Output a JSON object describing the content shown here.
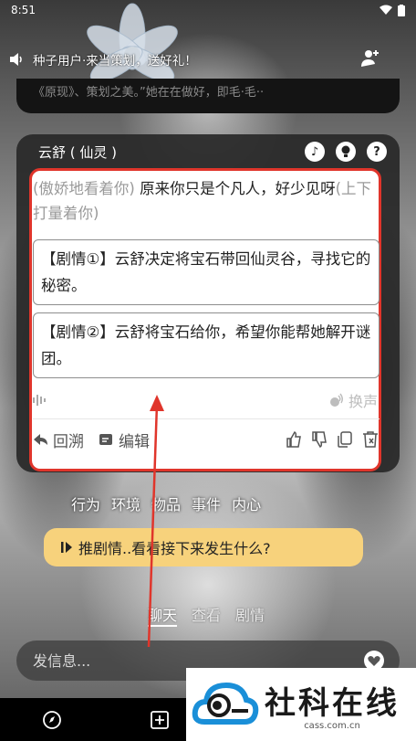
{
  "status_bar": {
    "time": "8:51"
  },
  "announcement": {
    "text": "种子用户·来当策划，送好礼！"
  },
  "previous_message": {
    "text": "《原现》、策划之美。”她在在做好，即毛·毛··"
  },
  "character": {
    "name": "云舒 ( 仙灵 )"
  },
  "message": {
    "action1": "(傲娇地看着你)",
    "speech": " 原来你只是个凡人，好少见呀",
    "action2": "(上下打量着你)"
  },
  "options": [
    {
      "text": "【剧情①】云舒决定将宝石带回仙灵谷，寻找它的秘密。"
    },
    {
      "text": "【剧情②】云舒将宝石给你，希望你能帮她解开谜团。"
    }
  ],
  "voice": {
    "change_label": "换声"
  },
  "actions": {
    "rewind_label": "回溯",
    "edit_label": "编辑"
  },
  "suggest_tabs": [
    "行为",
    "环境",
    "物品",
    "事件",
    "内心"
  ],
  "plot_button": {
    "label": "推剧情..看看接下来发生什么?"
  },
  "bottom_tabs": [
    "聊天",
    "查看",
    "剧情"
  ],
  "input": {
    "placeholder": "发信息..."
  },
  "watermark": {
    "title": "社科在线",
    "url": "cass.com.cn"
  },
  "colors": {
    "highlight_border": "#e0352b",
    "plot_button_bg": "#f7d27c",
    "card_bg": "#282828"
  }
}
